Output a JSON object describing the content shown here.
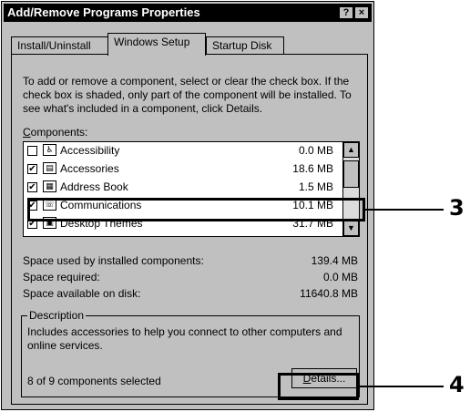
{
  "window": {
    "title": "Add/Remove Programs Properties",
    "help_btn": "?",
    "close_btn": "×"
  },
  "tabs": [
    {
      "label": "Install/Uninstall"
    },
    {
      "label": "Windows Setup"
    },
    {
      "label": "Startup Disk"
    }
  ],
  "intro_text": "To add or remove a component, select or clear the check box. If the check box is shaded, only part of the component will be installed. To see what's included in a component, click Details.",
  "components_label": "Components:",
  "components": [
    {
      "name": "Accessibility",
      "size": "0.0 MB",
      "checked": false,
      "icon": "accessibility-icon"
    },
    {
      "name": "Accessories",
      "size": "18.6 MB",
      "checked": true,
      "icon": "accessories-icon"
    },
    {
      "name": "Address Book",
      "size": "1.5 MB",
      "checked": true,
      "icon": "address-book-icon"
    },
    {
      "name": "Communications",
      "size": "10.1 MB",
      "checked": true,
      "icon": "communications-icon"
    },
    {
      "name": "Desktop Themes",
      "size": "31.7 MB",
      "checked": true,
      "icon": "desktop-themes-icon"
    }
  ],
  "space": [
    {
      "label": "Space used by installed components:",
      "value": "139.4 MB"
    },
    {
      "label": "Space required:",
      "value": "0.0 MB"
    },
    {
      "label": "Space available on disk:",
      "value": "11640.8 MB"
    }
  ],
  "description": {
    "legend": "Description",
    "text": "Includes accessories to help you connect to other computers and online services.",
    "count": "8 of 9 components selected",
    "details_btn": "Details..."
  },
  "callouts": {
    "c3": "3",
    "c4": "4"
  }
}
